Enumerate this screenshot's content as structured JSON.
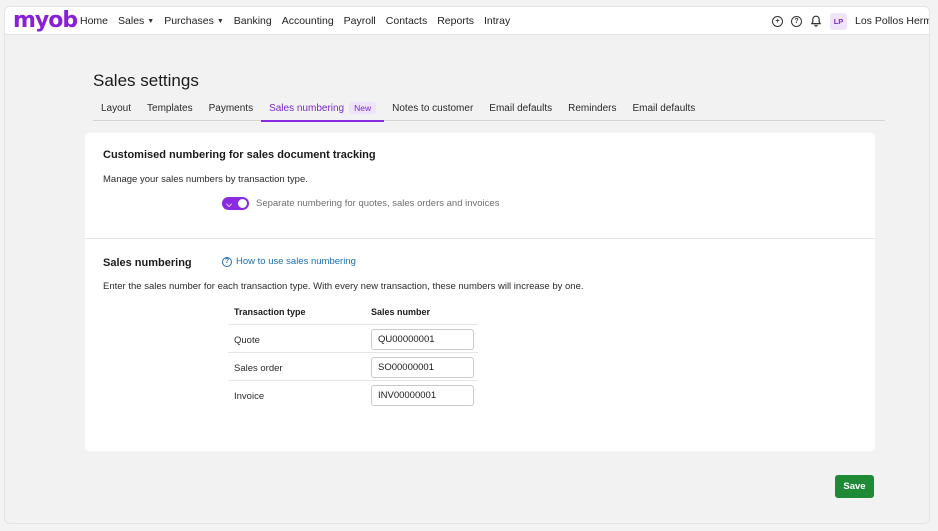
{
  "app": {
    "logo": "myob"
  },
  "nav": {
    "items": [
      {
        "label": "Home",
        "dropdown": false
      },
      {
        "label": "Sales",
        "dropdown": true
      },
      {
        "label": "Purchases",
        "dropdown": true
      },
      {
        "label": "Banking",
        "dropdown": false
      },
      {
        "label": "Accounting",
        "dropdown": false
      },
      {
        "label": "Payroll",
        "dropdown": false
      },
      {
        "label": "Contacts",
        "dropdown": false
      },
      {
        "label": "Reports",
        "dropdown": false
      },
      {
        "label": "Intray",
        "dropdown": false
      }
    ],
    "avatar_initials": "LP",
    "business_name": "Los Pollos Herm"
  },
  "page": {
    "title": "Sales settings"
  },
  "tabs": [
    {
      "label": "Layout",
      "active": false
    },
    {
      "label": "Templates",
      "active": false
    },
    {
      "label": "Payments",
      "active": false
    },
    {
      "label": "Sales numbering",
      "active": true,
      "badge": "New"
    },
    {
      "label": "Notes to customer",
      "active": false
    },
    {
      "label": "Email defaults",
      "active": false
    },
    {
      "label": "Reminders",
      "active": false
    },
    {
      "label": "Email defaults",
      "active": false
    }
  ],
  "tracking": {
    "heading": "Customised numbering for sales document tracking",
    "description": "Manage your sales numbers by transaction type.",
    "toggle_label": "Separate numbering for quotes, sales orders and invoices",
    "toggle_on": true
  },
  "numbering": {
    "heading": "Sales numbering",
    "help_link": "How to use sales numbering",
    "description": "Enter the sales number for each transaction type. With every new transaction, these numbers will increase by one.",
    "col_type": "Transaction type",
    "col_number": "Sales number",
    "rows": [
      {
        "type": "Quote",
        "number": "QU00000001"
      },
      {
        "type": "Sales order",
        "number": "SO00000001"
      },
      {
        "type": "Invoice",
        "number": "INV00000001"
      }
    ]
  },
  "actions": {
    "save_label": "Save"
  },
  "colors": {
    "brand": "#8a1fd6",
    "accent": "#8a2be2",
    "save": "#1e8a36",
    "link": "#1b6fb3"
  }
}
